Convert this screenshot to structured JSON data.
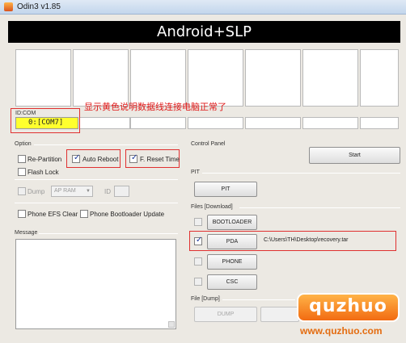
{
  "window": {
    "title": "Odin3 v1.85"
  },
  "banner": {
    "text": "Android+SLP"
  },
  "idcom": {
    "label": "ID:COM",
    "value": "0:[COM7]"
  },
  "annotation": {
    "text": "显示黄色说明数据线连接电脑正常了"
  },
  "option": {
    "label": "Option",
    "re_partition": {
      "label": "Re-Partition",
      "checked": false
    },
    "auto_reboot": {
      "label": "Auto Reboot",
      "checked": true
    },
    "f_reset_time": {
      "label": "F. Reset Time",
      "checked": true
    },
    "flash_lock": {
      "label": "Flash Lock",
      "checked": false
    },
    "dump": {
      "label": "Dump",
      "checked": false,
      "enabled": false
    },
    "dump_type": {
      "selected": "AP RAM"
    },
    "id_label": "ID",
    "phone_efs_clear": {
      "label": "Phone EFS Clear",
      "checked": false
    },
    "phone_bootloader_update": {
      "label": "Phone Bootloader Update",
      "checked": false
    }
  },
  "message": {
    "label": "Message"
  },
  "control_panel": {
    "label": "Control Panel",
    "start_label": "Start"
  },
  "pit": {
    "label": "PIT",
    "button_label": "PIT"
  },
  "files": {
    "label": "Files [Download]",
    "bootloader": {
      "label": "BOOTLOADER",
      "checked": false
    },
    "pda": {
      "label": "PDA",
      "checked": true,
      "path": "C:\\Users\\TH\\Desktop\\recovery.tar"
    },
    "phone": {
      "label": "PHONE",
      "checked": false
    },
    "csc": {
      "label": "CSC",
      "checked": false
    }
  },
  "file_dump": {
    "label": "File [Dump]",
    "button_label": "DUMP"
  },
  "watermark": {
    "brand": "quzhuo",
    "url": "www.quzhuo.com"
  },
  "colors": {
    "com_active": "#ffff2e",
    "annotation": "#e01818",
    "banner_bg": "#000000"
  }
}
